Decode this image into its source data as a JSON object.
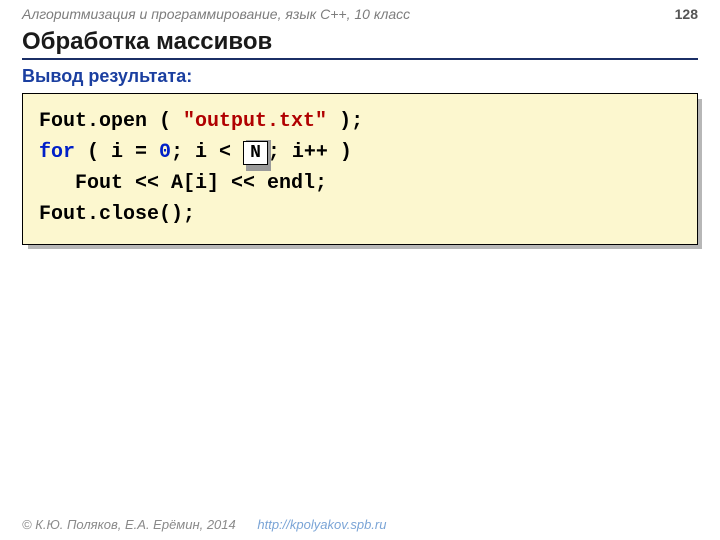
{
  "header": {
    "course": "Алгоритмизация и программирование, язык C++, 10 класс",
    "page": "128"
  },
  "title": "Обработка массивов",
  "subtitle": "Вывод результата:",
  "code": {
    "l1a": "Fout.open ( ",
    "l1b": "\"output.txt\"",
    "l1c": " );",
    "l2a": "for",
    "l2b": " ( i = ",
    "l2c": "0",
    "l2d": "; i < ",
    "l2e": "; i++ )",
    "nbox": "N",
    "l3": "Fout << A[i] << endl;",
    "l4": "Fout.close();"
  },
  "footer": {
    "copyright": "© К.Ю. Поляков, Е.А. Ерёмин, 2014",
    "url": "http://kpolyakov.spb.ru"
  }
}
